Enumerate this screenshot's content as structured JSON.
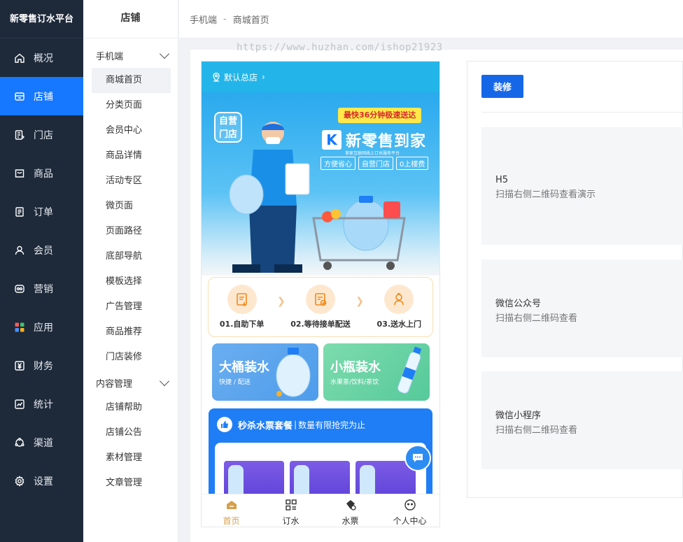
{
  "brand": "新零售订水平台",
  "nav": [
    {
      "label": "概况",
      "icon": "home-icon"
    },
    {
      "label": "店铺",
      "icon": "store-icon",
      "active": true
    },
    {
      "label": "门店",
      "icon": "shop-list-icon"
    },
    {
      "label": "商品",
      "icon": "product-icon"
    },
    {
      "label": "订单",
      "icon": "order-icon"
    },
    {
      "label": "会员",
      "icon": "user-icon"
    },
    {
      "label": "营销",
      "icon": "marketing-icon"
    },
    {
      "label": "应用",
      "icon": "apps-icon"
    },
    {
      "label": "财务",
      "icon": "finance-icon"
    },
    {
      "label": "统计",
      "icon": "chart-icon"
    },
    {
      "label": "渠道",
      "icon": "channel-icon"
    },
    {
      "label": "设置",
      "icon": "settings-icon"
    }
  ],
  "sub": {
    "title": "店铺",
    "groups": [
      {
        "label": "手机端",
        "items": [
          "商城首页",
          "分类页面",
          "会员中心",
          "商品详情",
          "活动专区",
          "微页面",
          "页面路径",
          "底部导航",
          "模板选择",
          "广告管理",
          "商品推荐",
          "门店装修"
        ]
      },
      {
        "label": "内容管理",
        "items": [
          "店铺帮助",
          "店铺公告",
          "素材管理",
          "文章管理"
        ]
      }
    ]
  },
  "breadcrumb": {
    "parent": "手机端",
    "separator": "-",
    "current": "商城首页"
  },
  "watermark": "https://www.huzhan.com/ishop21923",
  "phone": {
    "location": "默认总店",
    "banner": {
      "badge_line1": "自营",
      "badge_line2": "门店",
      "fast_tag": "最快36分钟极速送达",
      "logo_letter": "K",
      "logo_name": "新零售到家",
      "logo_sub": "首家互联网线上订水服务平台",
      "chips": [
        "方便省心",
        "自营门店",
        "0上楼费"
      ]
    },
    "steps": [
      "01.自助下单",
      "02.等待接单配送",
      "03.送水上门"
    ],
    "promos": [
      {
        "title": "大桶装水",
        "desc": "快捷 / 配送"
      },
      {
        "title": "小瓶装水",
        "desc": "水果茶/饮料/茶饮"
      }
    ],
    "flash": {
      "title": "秒杀水票套餐",
      "divider": "|",
      "subtitle": "数量有限抢完为止"
    },
    "tabs": [
      "首页",
      "订水",
      "水票",
      "个人中心"
    ]
  },
  "panel": {
    "button": "装修",
    "cards": [
      {
        "title": "H5",
        "desc": "扫描右侧二维码查看演示"
      },
      {
        "title": "微信公众号",
        "desc": "扫描右侧二维码查看"
      },
      {
        "title": "微信小程序",
        "desc": "扫描右侧二维码查看"
      }
    ]
  },
  "colors": {
    "nav_bg": "#1e2a3a",
    "accent": "#1677ff",
    "button": "#1667e8",
    "tab_active": "#d4a04a"
  }
}
